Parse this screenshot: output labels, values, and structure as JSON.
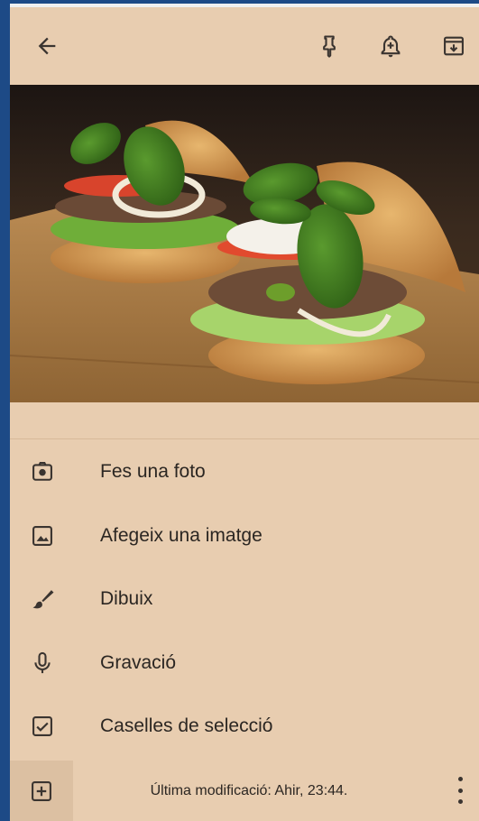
{
  "toolbar": {
    "back_icon": "arrow-left-icon",
    "pin_icon": "pin-icon",
    "reminder_icon": "bell-plus-icon",
    "archive_icon": "archive-icon"
  },
  "image": {
    "subject": "burger photo"
  },
  "menu": {
    "items": [
      {
        "label": "Fes una foto",
        "icon": "camera-icon"
      },
      {
        "label": "Afegeix una imatge",
        "icon": "image-icon"
      },
      {
        "label": "Dibuix",
        "icon": "brush-icon"
      },
      {
        "label": "Gravació",
        "icon": "microphone-icon"
      },
      {
        "label": "Caselles de selecció",
        "icon": "checkbox-icon"
      }
    ]
  },
  "bottombar": {
    "status": "Última modificació: Ahir, 23:44.",
    "add_icon": "add-box-icon",
    "more_icon": "more-vert-icon"
  },
  "colors": {
    "background": "#e8cdb0",
    "icon": "#3a3430",
    "text": "#2b2622",
    "frame": "#1d4a86"
  }
}
